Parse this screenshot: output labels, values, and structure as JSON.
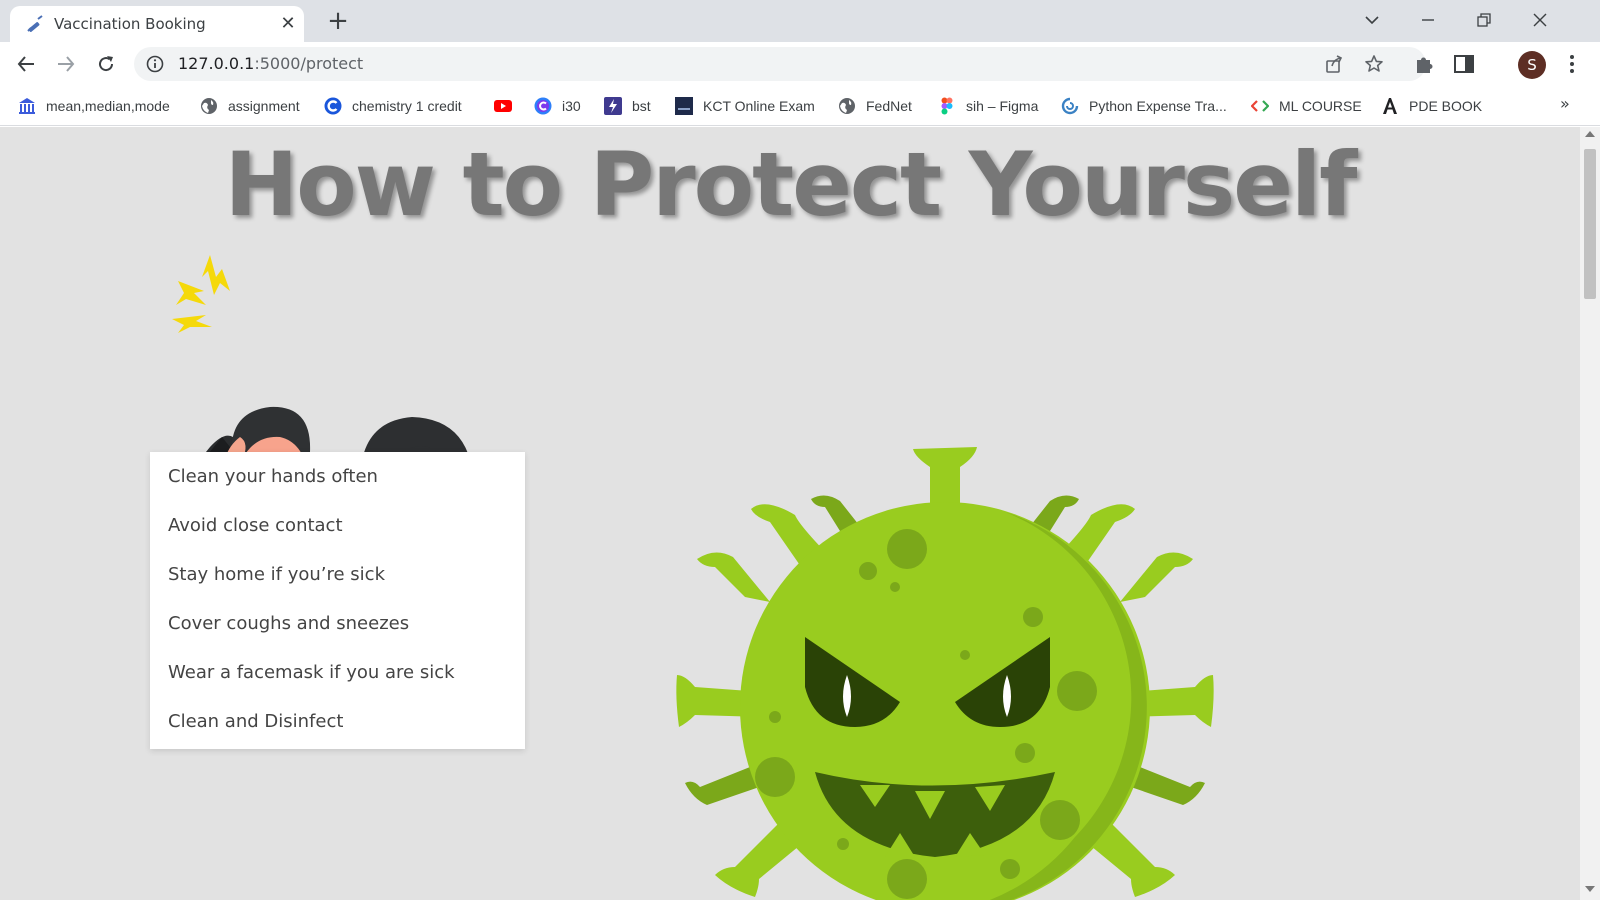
{
  "tab": {
    "title": "Vaccination Booking",
    "close_glyph": "✕",
    "favicon": "vaccine-icon"
  },
  "newtab_glyph": "+",
  "address": {
    "url_host": "127.0.0.1",
    "url_rest": ":5000/protect"
  },
  "bookmarks": [
    {
      "label": "mean,median,mode",
      "icon": "bank-icon"
    },
    {
      "label": "assignment",
      "icon": "globe-icon"
    },
    {
      "label": "chemistry 1 credit",
      "icon": "c-logo-icon"
    },
    {
      "label": "",
      "icon": "youtube-icon"
    },
    {
      "label": "i30",
      "icon": "c-circle-icon"
    },
    {
      "label": "bst",
      "icon": "bolt-icon"
    },
    {
      "label": "KCT Online Exam",
      "icon": "kct-icon"
    },
    {
      "label": "FedNet",
      "icon": "globe-icon"
    },
    {
      "label": "sih – Figma",
      "icon": "figma-icon"
    },
    {
      "label": "Python Expense Tra...",
      "icon": "python-icon"
    },
    {
      "label": "ML COURSE",
      "icon": "code-icon"
    },
    {
      "label": "PDE BOOK",
      "icon": "a-letter-icon"
    }
  ],
  "bookmarks_more": "»",
  "profile_initial": "S",
  "page": {
    "title": "How to Protect Yourself",
    "tips": [
      "Clean your hands often",
      "Avoid close contact",
      "Stay home if you’re sick",
      "Cover coughs and sneezes",
      "Wear a facemask if you are sick",
      "Clean and Disinfect"
    ]
  },
  "colors": {
    "virus_green": "#99cc1f",
    "virus_dark": "#7ba81a",
    "page_bg": "#e2e2e2"
  }
}
